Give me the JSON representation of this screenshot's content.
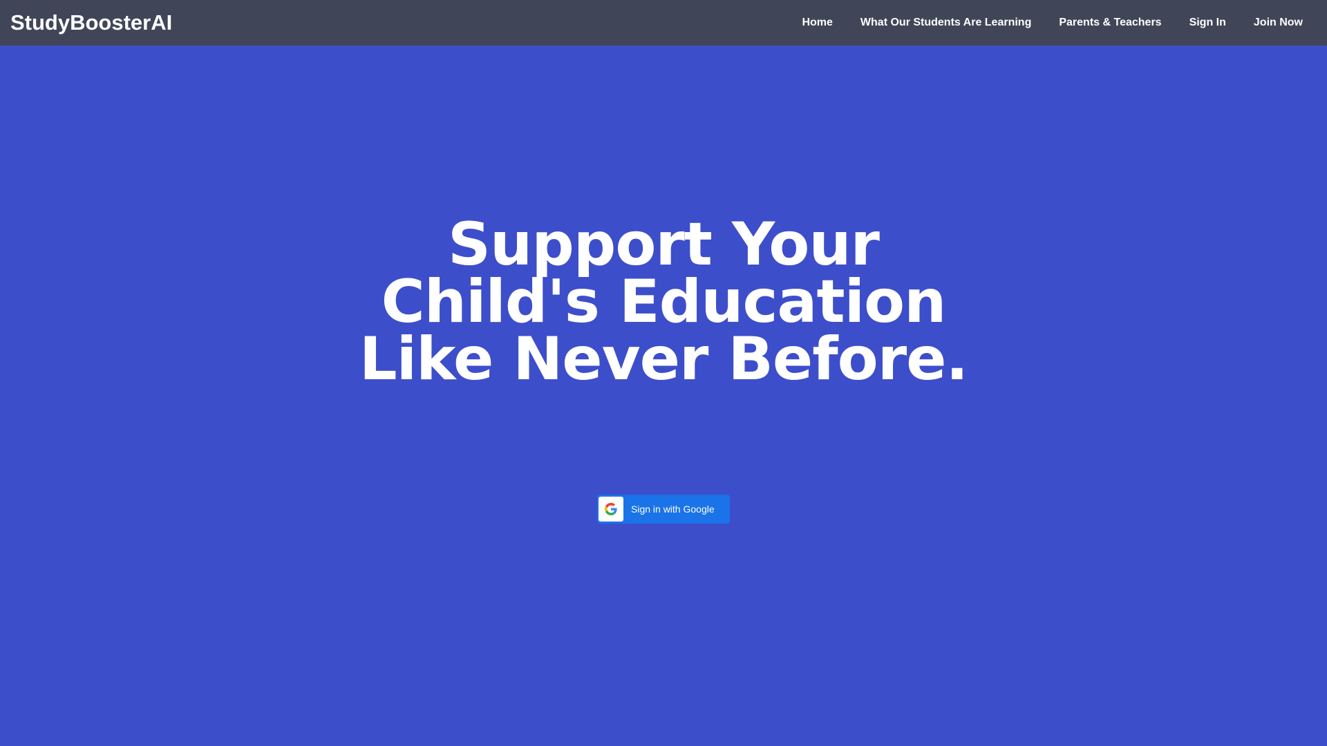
{
  "brand": {
    "name": "StudyBoosterAI"
  },
  "nav": {
    "items": [
      {
        "label": "Home"
      },
      {
        "label": "What Our Students Are Learning"
      },
      {
        "label": "Parents & Teachers"
      },
      {
        "label": "Sign In"
      },
      {
        "label": "Join Now"
      }
    ]
  },
  "hero": {
    "title_lines": [
      "Support Your",
      "Child's Education",
      "Like Never Before."
    ],
    "google_button": {
      "label": "Sign in with Google",
      "icon": "google-g-icon"
    }
  },
  "colors": {
    "hero_background": "#3d4ecb",
    "navbar_background": "#414558",
    "google_button": "#1a73e8",
    "text": "#ffffff"
  }
}
